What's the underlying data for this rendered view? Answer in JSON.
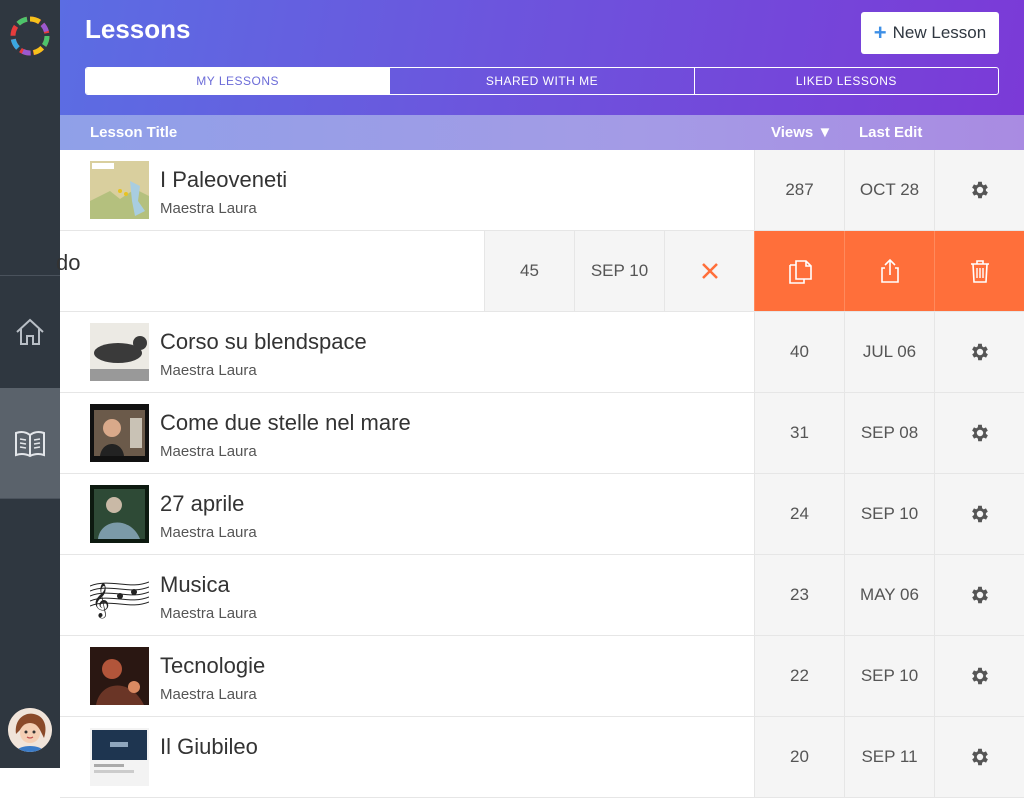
{
  "header": {
    "title": "Lessons",
    "new_lesson_label": "New Lesson",
    "tabs": [
      {
        "label": "MY LESSONS",
        "active": true
      },
      {
        "label": "SHARED WITH ME",
        "active": false
      },
      {
        "label": "LIKED LESSONS",
        "active": false
      }
    ]
  },
  "columns": {
    "title": "Lesson Title",
    "views": "Views",
    "last_edit": "Last Edit"
  },
  "colors": {
    "sidebar": "#2f3740",
    "accent_orange": "#ff6f3a",
    "plus_blue": "#3d8fe6"
  },
  "sidebar": {
    "items": [
      {
        "icon": "home-icon"
      },
      {
        "icon": "book-icon",
        "active": true
      }
    ]
  },
  "swiped_row": {
    "title_fragment": "do",
    "views": "45",
    "last_edit": "SEP 10",
    "actions": [
      "copy-icon",
      "share-icon",
      "trash-icon"
    ]
  },
  "lessons": [
    {
      "title": "I Paleoveneti",
      "author": "Maestra Laura",
      "views": "287",
      "last_edit": "OCT 28"
    },
    {
      "title": "Corso su blendspace",
      "author": "Maestra Laura",
      "views": "40",
      "last_edit": "JUL 06"
    },
    {
      "title": "Come due stelle nel mare",
      "author": "Maestra Laura",
      "views": "31",
      "last_edit": "SEP 08"
    },
    {
      "title": "27 aprile",
      "author": "Maestra Laura",
      "views": "24",
      "last_edit": "SEP 10"
    },
    {
      "title": "Musica",
      "author": "Maestra Laura",
      "views": "23",
      "last_edit": "MAY 06"
    },
    {
      "title": "Tecnologie",
      "author": "Maestra Laura",
      "views": "22",
      "last_edit": "SEP 10"
    },
    {
      "title": "Il Giubileo",
      "author": "",
      "views": "20",
      "last_edit": "SEP 11"
    }
  ]
}
